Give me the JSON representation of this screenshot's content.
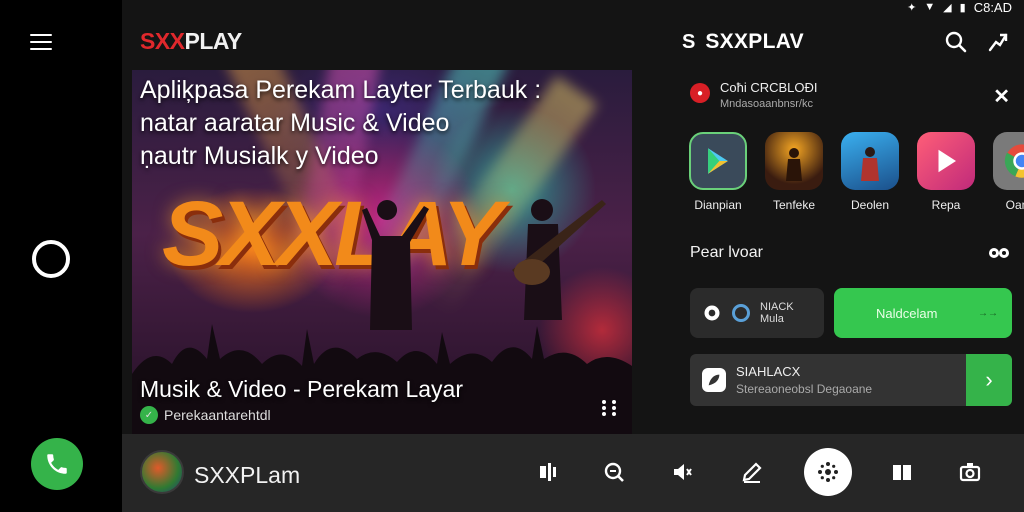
{
  "statusbar": {
    "time": "C8:AD"
  },
  "header": {
    "logo_left_part1": "SXX",
    "logo_left_part2": "PLAY",
    "brand_letter": "S",
    "brand_name": "SXXPLAV"
  },
  "hero": {
    "title_line1": "Apliķpasa Perekam Layter Terbauk :",
    "title_line2": "natar aaratar Music & Video",
    "title_line3": "ṇautr Musialk y Video",
    "big_brand": "SXXLAY",
    "caption": "Musik & Video - Perekam Layar",
    "sub": "Perekaantarehtdl"
  },
  "panel": {
    "rec_title": "Coħi CRCBLOĐI",
    "rec_sub": "Mndasoaanbnsr/kc",
    "apps": [
      {
        "label": "Dianpian",
        "icon": "play-store-icon",
        "bg": "#3a4a5a"
      },
      {
        "label": "Tenfeke",
        "icon": "concert-thumbnail-icon",
        "bg": "#3a1c10"
      },
      {
        "label": "Deolen",
        "icon": "performer-thumbnail-icon",
        "bg": "#1f6fb2"
      },
      {
        "label": "Repa",
        "icon": "play-icon",
        "bg": "#e04a7a"
      },
      {
        "label": "Oamd",
        "icon": "chrome-icon",
        "bg": "#888888"
      }
    ],
    "section_label": "Pear lvoar",
    "row1_line1": "NIACK",
    "row1_line2": "Mula",
    "green_button": "Naldcelam",
    "green_arrow": "→→",
    "row2_title": "SIAHLACX",
    "row2_sub": "Stereaoneobsl Degaoane",
    "row2_go": "›"
  },
  "bottombar": {
    "name": "SXXPLam"
  },
  "colors": {
    "accent_green": "#35b34a",
    "brand_red": "#e0282c",
    "brand_orange": "#f28a1a"
  }
}
